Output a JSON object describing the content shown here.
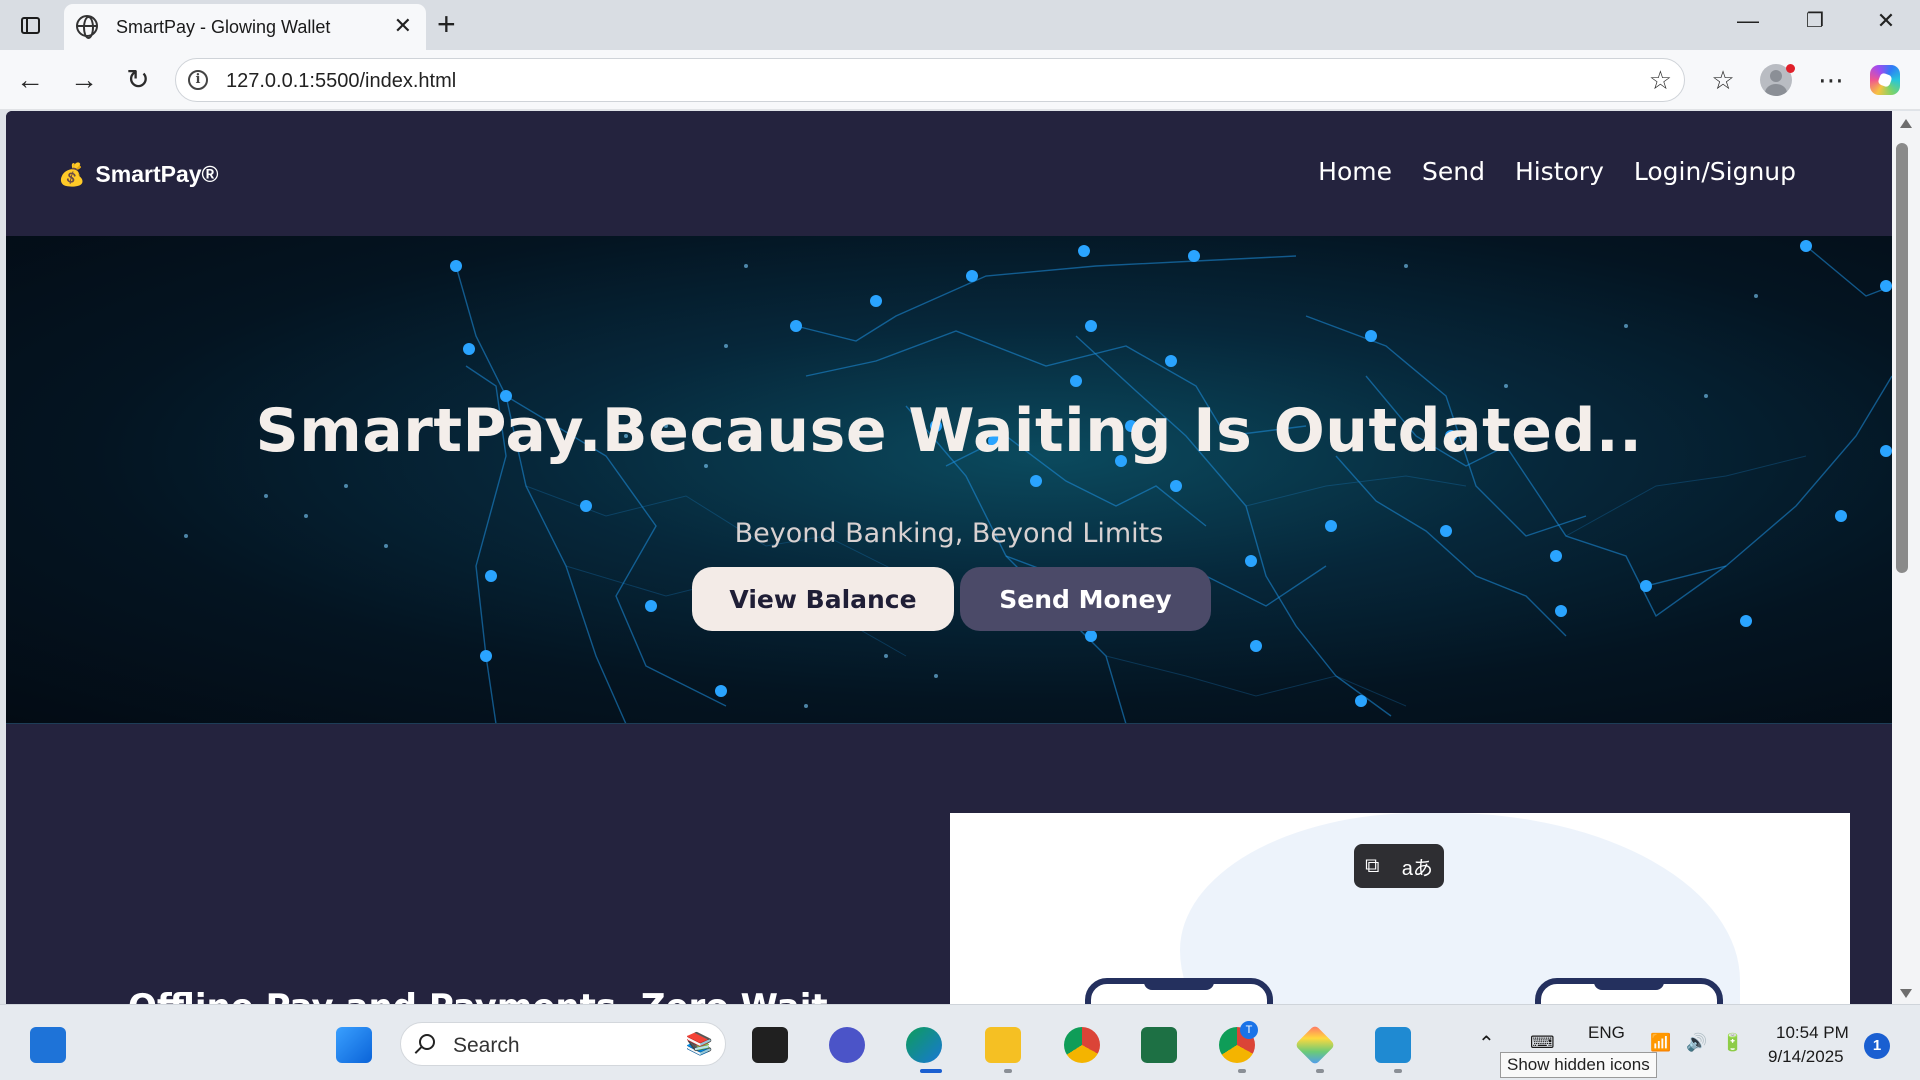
{
  "browser": {
    "tab_title": "SmartPay - Glowing Wallet",
    "url": "127.0.0.1:5500/index.html"
  },
  "site": {
    "brand": "SmartPay®",
    "brand_icon": "money-bag-icon",
    "nav": [
      "Home",
      "Send",
      "History",
      "Login/Signup"
    ]
  },
  "hero": {
    "title": "SmartPay.Because Waiting Is Outdated..",
    "subtitle": "Beyond Banking, Beyond Limits",
    "primary_button": "View Balance",
    "secondary_button": "Send Money"
  },
  "section": {
    "heading_partial": "Offline Pay and Payments. Zero Wait"
  },
  "taskbar": {
    "search_placeholder": "Search",
    "language": "ENG",
    "time": "10:54 PM",
    "date": "9/14/2025",
    "notification_count": "1",
    "tooltip": "Show hidden icons",
    "chrome_badge": "T"
  },
  "colors": {
    "page_bg": "#24233e",
    "hero_bg": "#041421",
    "network": "#1e90ff",
    "primary_btn": "#f3ebe7",
    "secondary_btn": "#4b4a68"
  }
}
